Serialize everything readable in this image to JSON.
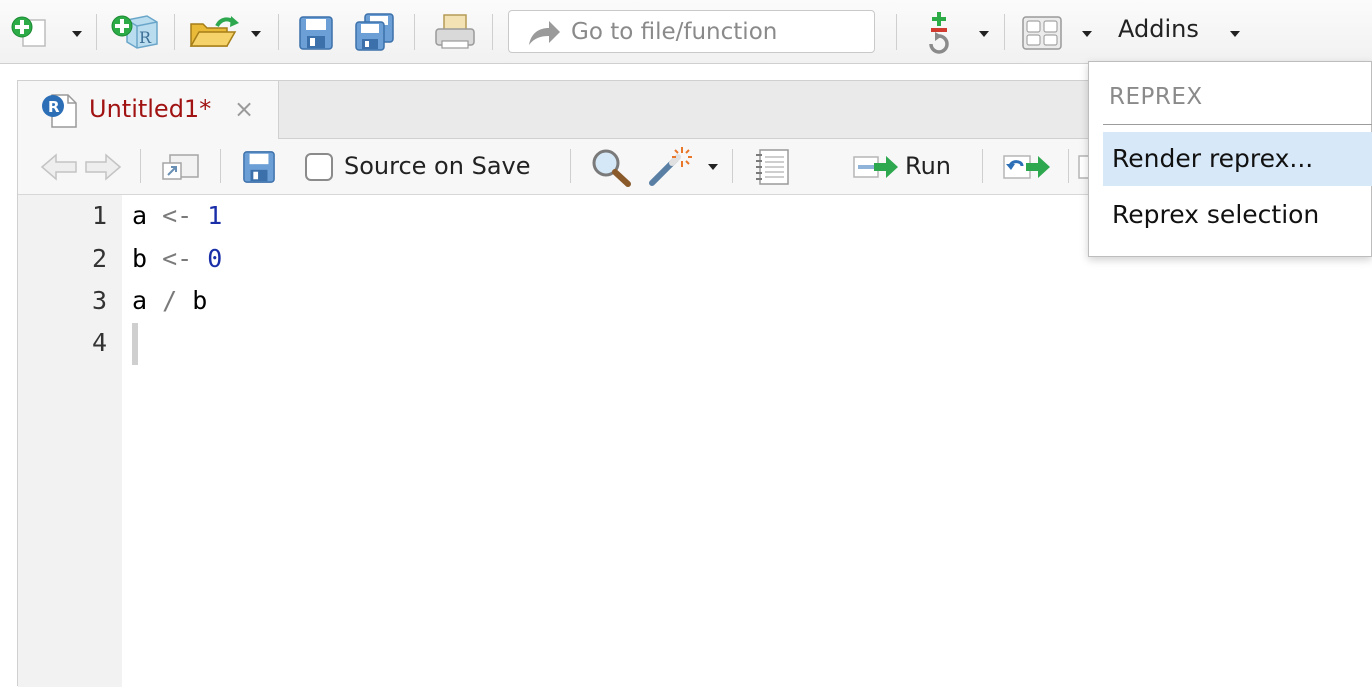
{
  "toolbar": {
    "goto_placeholder": "Go to file/function",
    "addins_label": "Addins"
  },
  "editor": {
    "tab_title": "Untitled1*",
    "tab_close": "×",
    "source_on_save_label": "Source on Save",
    "source_on_save_checked": false,
    "run_label": "Run",
    "line_numbers": [
      "1",
      "2",
      "3",
      "4"
    ],
    "code_lines": [
      {
        "var": "a",
        "op": " <- ",
        "val": "1"
      },
      {
        "var": "b",
        "op": " <- ",
        "val": "0"
      },
      {
        "var": "a",
        "op": " / ",
        "val": "b"
      }
    ]
  },
  "addins_menu": {
    "section_header": "REPREX",
    "items": [
      {
        "label": "Render reprex...",
        "active": true
      },
      {
        "label": "Reprex selection",
        "active": false
      }
    ]
  },
  "colors": {
    "tab_title": "#a11212",
    "number_literal": "#1a2ea8",
    "menu_highlight": "#d7e8f8",
    "run_arrow": "#2ea84f",
    "new_file_green": "#2cab47"
  }
}
